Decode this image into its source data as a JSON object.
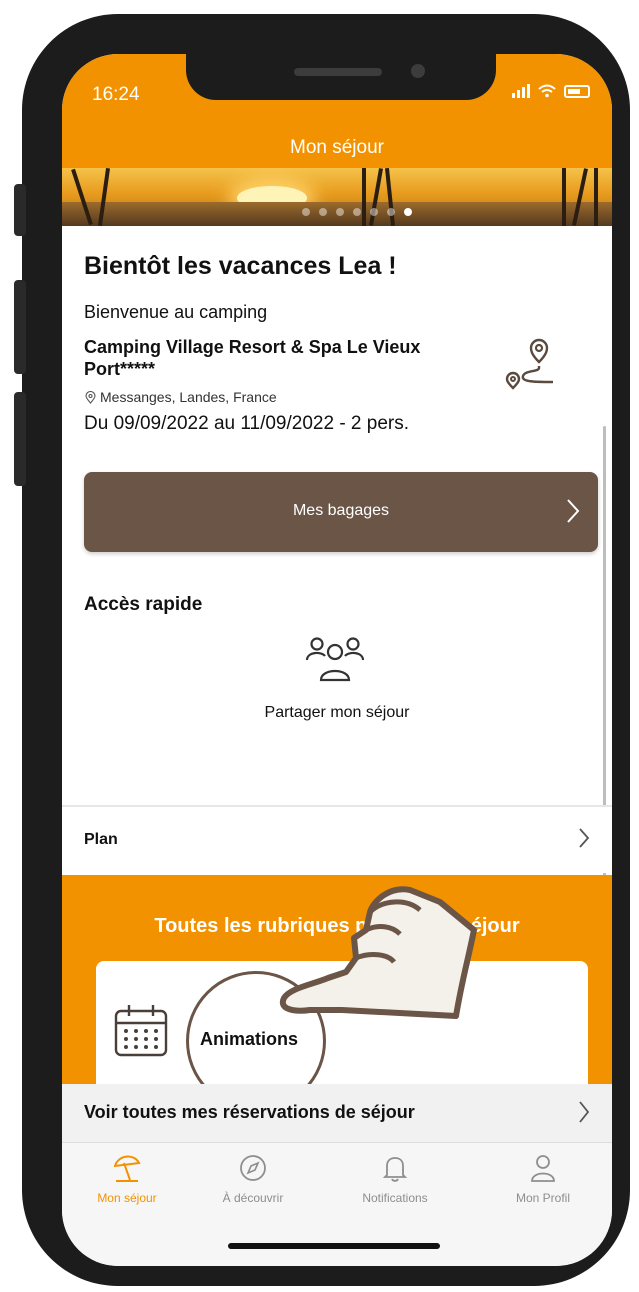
{
  "status": {
    "time": "16:24"
  },
  "header": {
    "title": "Mon séjour"
  },
  "carousel": {
    "count": 7,
    "active_index": 6
  },
  "stay": {
    "greeting": "Bientôt les vacances Lea !",
    "welcome": "Bienvenue au camping",
    "camping_name": "Camping Village Resort & Spa Le Vieux Port*****",
    "location": "Messanges, Landes, France",
    "dates": "Du 09/09/2022 au 11/09/2022 - 2 pers.",
    "bagages_label": "Mes bagages"
  },
  "quick_access": {
    "title": "Accès rapide",
    "share_label": "Partager mon séjour"
  },
  "plan": {
    "label": "Plan"
  },
  "rubriques": {
    "title": "Toutes les rubriques pour votre séjour",
    "card_label": "Animations"
  },
  "reservations": {
    "label": "Voir toutes mes réservations de séjour"
  },
  "tabbar": {
    "items": [
      {
        "label": "Mon séjour",
        "icon": "umbrella-icon",
        "active": true
      },
      {
        "label": "À découvrir",
        "icon": "compass-icon",
        "active": false
      },
      {
        "label": "Notifications",
        "icon": "bell-icon",
        "active": false
      },
      {
        "label": "Mon Profil",
        "icon": "profile-icon",
        "active": false
      }
    ]
  },
  "colors": {
    "accent": "#F39200",
    "brown": "#6b5547"
  }
}
